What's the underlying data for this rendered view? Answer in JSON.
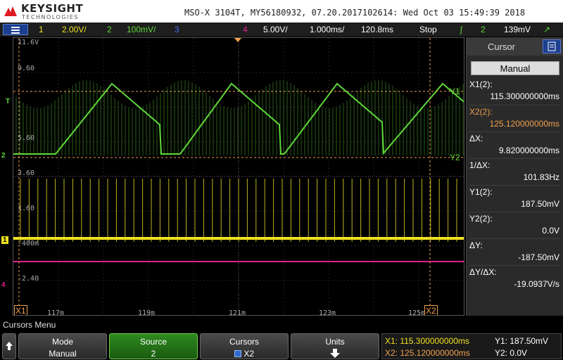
{
  "header": {
    "brand": "KEYSIGHT",
    "brand_sub": "TECHNOLOGIES",
    "title": "MSO-X 3104T, MY56180932, 07.20.2017102614: Wed Oct 03 15:49:39 2018"
  },
  "status_bar": {
    "ch1_num": "1",
    "ch1_scale": "2.00V/",
    "ch2_num": "2",
    "ch2_scale": "100mV/",
    "ch3_num": "3",
    "ch4_num": "4",
    "ch4_scale": "5.00V/",
    "timebase": "1.000ms/",
    "delay": "120.8ms",
    "run_state": "Stop",
    "trigger_source": "2",
    "trigger_level": "139mV",
    "colors": {
      "ch1": "#f0e020",
      "ch2": "#5fd93a",
      "ch3": "#4a6cf0",
      "ch4": "#e0208a"
    }
  },
  "plot": {
    "y_labels": [
      "11.6V",
      "9.60",
      "5.60",
      "3.60",
      "1.60",
      "-400m",
      "-2.40"
    ],
    "x_labels": [
      "117m",
      "119m",
      "121m",
      "123m",
      "125m"
    ],
    "cursor_x1_label": "X1",
    "cursor_x2_label": "X2",
    "cursor_y1_label": "Y1",
    "cursor_y2_label": "Y2",
    "ch1_marker": "1",
    "ch2_marker": "2",
    "ch4_marker": "4",
    "trigger_marker": "T"
  },
  "cursor_panel": {
    "title": "Cursor",
    "mode": "Manual",
    "x1_label": "X1(2):",
    "x1_value": "115.300000000ms",
    "x2_label": "X2(2):",
    "x2_value": "125.120000000ms",
    "dx_label": "ΔX:",
    "dx_value": "9.820000000ms",
    "inv_dx_label": "1/ΔX:",
    "inv_dx_value": "101.83Hz",
    "y1_label": "Y1(2):",
    "y1_value": "187.50mV",
    "y2_label": "Y2(2):",
    "y2_value": "0.0V",
    "dy_label": "ΔY:",
    "dy_value": "-187.50mV",
    "dydx_label": "ΔY/ΔX:",
    "dydx_value": "-19.0937V/s"
  },
  "softkeys": {
    "menu_label": "Cursors Menu",
    "mode_top": "Mode",
    "mode_bottom": "Manual",
    "source_top": "Source",
    "source_bottom": "2",
    "cursors_top": "Cursors",
    "cursors_bottom": "X2",
    "units_top": "Units"
  },
  "readout": {
    "x1": "X1: 115.300000000ms",
    "x2": "X2: 125.120000000ms",
    "y1": "Y1: 187.50mV",
    "y2": "Y2: 0.0V"
  }
}
